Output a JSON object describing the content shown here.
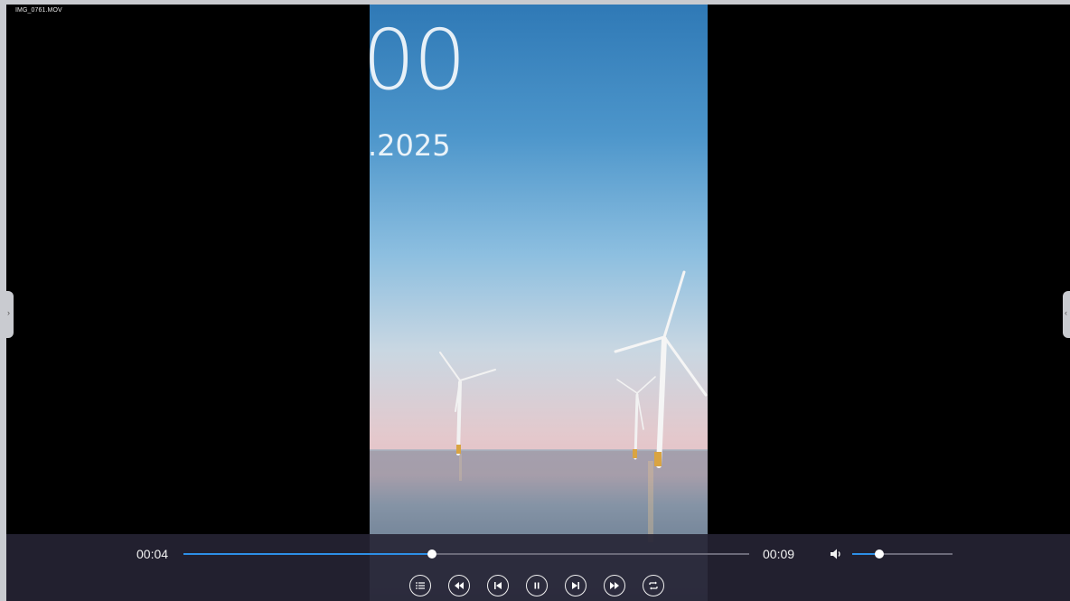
{
  "window": {
    "file_name": "IMG_0761.MOV"
  },
  "video_overlay": {
    "clock_time": "00",
    "clock_date": ".2025"
  },
  "side_handles": {
    "left_icon": "chevron-right-icon",
    "right_icon": "chevron-left-icon",
    "left_glyph": "›",
    "right_glyph": "‹"
  },
  "playback": {
    "current_time": "00:04",
    "total_time": "00:09",
    "progress": 0.44,
    "volume": 0.27
  },
  "controls": [
    {
      "name": "playlist-button",
      "icon": "list-icon"
    },
    {
      "name": "rewind-button",
      "icon": "rewind-icon"
    },
    {
      "name": "previous-button",
      "icon": "skip-previous-icon"
    },
    {
      "name": "pause-button",
      "icon": "pause-icon"
    },
    {
      "name": "next-button",
      "icon": "skip-next-icon"
    },
    {
      "name": "fast-forward-button",
      "icon": "fast-forward-icon"
    },
    {
      "name": "repeat-button",
      "icon": "repeat-icon"
    }
  ],
  "colors": {
    "accent": "#2d8fe6",
    "control_bar": "#262434",
    "background": "#000000"
  }
}
